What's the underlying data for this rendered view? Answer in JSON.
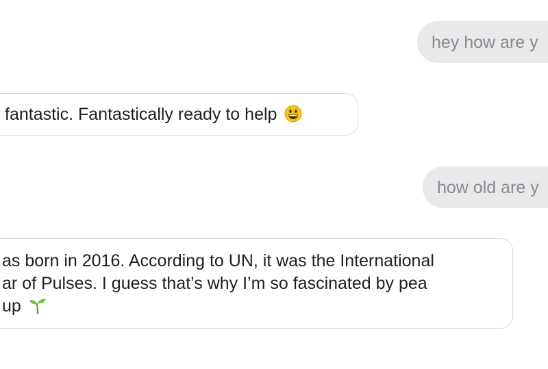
{
  "conversation": {
    "messages": [
      {
        "role": "user",
        "text": "hey how are y"
      },
      {
        "role": "bot",
        "text": "fantastic. Fantastically ready to help",
        "emoji": "grinning-face-emoji"
      },
      {
        "role": "user",
        "text": "how old are y"
      },
      {
        "role": "bot",
        "lines": [
          "as born in 2016. According to UN, it was the International",
          "ar of Pulses. I guess that’s why I’m so fascinated by pea",
          "up"
        ],
        "emoji": "seedling-emoji"
      }
    ]
  },
  "colors": {
    "user_bubble_bg": "#e9e9eb",
    "user_text": "#8a8a8e",
    "bot_bubble_border": "#dadbe0",
    "bot_text": "#1f1f1f"
  }
}
